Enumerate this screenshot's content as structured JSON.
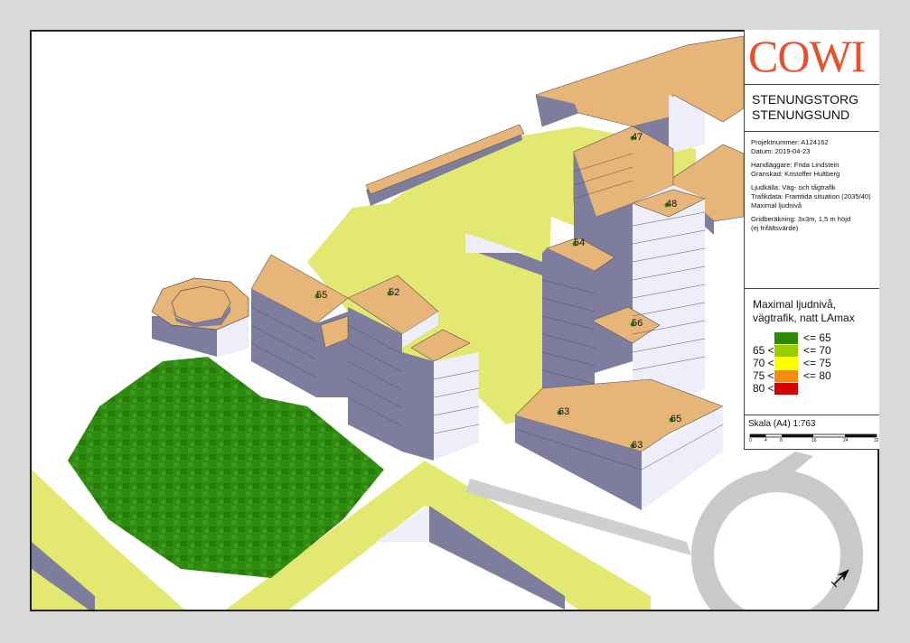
{
  "company": "COWI",
  "title": {
    "line1": "STENUNGSTORG",
    "line2": "STENUNGSUND"
  },
  "meta": {
    "projektnummer": "Projektnummer: A124162",
    "datum": "Datum: 2019-04-23",
    "handlaggare": "Handläggare: Frida Lindstein",
    "granskad": "Granskad: Kristoffer Hultberg",
    "ljudkalla": "Ljudkälla: Väg- och tågtrafik",
    "trafikdata": "Trafikdata: Framtida situation (2035/40)",
    "maximal": "Maximal ljudnivå",
    "grid1": "Gridberäkning: 3x3m, 1,5 m höjd",
    "grid2": "(ej frifältsvärde)"
  },
  "legend": {
    "title_line1": "Maximal ljudnivå,",
    "title_line2": "vägtrafik, natt LAmax",
    "rows": [
      {
        "lo": "",
        "hi": "<= 65",
        "color": "#2e8b00"
      },
      {
        "lo": "65 <",
        "hi": "<= 70",
        "color": "#9acd00"
      },
      {
        "lo": "70 <",
        "hi": "<= 75",
        "color": "#ffff00"
      },
      {
        "lo": "75 <",
        "hi": "<= 80",
        "color": "#f28c0f"
      },
      {
        "lo": "80 <",
        "hi": "",
        "color": "#d40000"
      }
    ]
  },
  "scale": {
    "label": "Skala (A4) 1:763",
    "ticks": [
      "0",
      "4",
      "8",
      "16",
      "24",
      "32"
    ]
  },
  "points": [
    {
      "id": "p47",
      "value": "47"
    },
    {
      "id": "p48",
      "value": "48"
    },
    {
      "id": "p54",
      "value": "54"
    },
    {
      "id": "p56",
      "value": "56"
    },
    {
      "id": "p55",
      "value": "55"
    },
    {
      "id": "p52",
      "value": "52"
    },
    {
      "id": "p63a",
      "value": "63"
    },
    {
      "id": "p65",
      "value": "65"
    },
    {
      "id": "p63b",
      "value": "63"
    }
  ],
  "colors": {
    "roof": "#e6b577",
    "wall": "#7f7d9e",
    "wall_light": "#eeeefb",
    "ground": "#e3e870",
    "road": "#c9c9c9",
    "noise_green": "#2e8b00"
  }
}
